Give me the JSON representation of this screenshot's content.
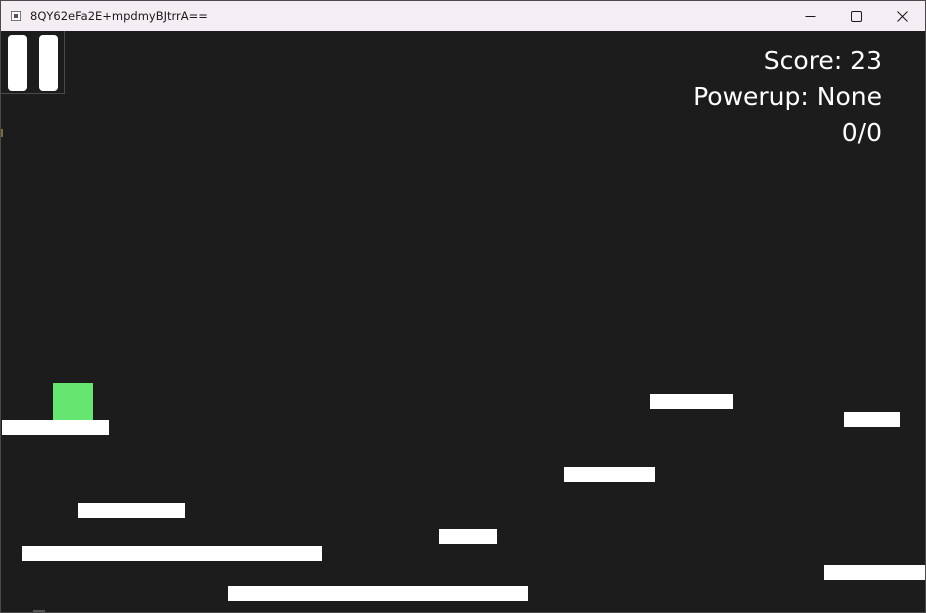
{
  "window": {
    "title": "8QY62eFa2E+mpdmyBJtrrA==",
    "controls": [
      "minimize",
      "maximize",
      "close"
    ]
  },
  "hud": {
    "score": "Score: 23",
    "powerup": "Powerup: None",
    "counter": "0/0"
  },
  "colors": {
    "background": "#1c1c1c",
    "platform": "#ffffff",
    "player": "#66e570",
    "hud_text": "#ffffff"
  },
  "icons": {
    "app": "app-icon",
    "pause": "pause-icon",
    "minimize": "minimize-icon",
    "maximize": "maximize-icon",
    "close": "close-icon"
  }
}
